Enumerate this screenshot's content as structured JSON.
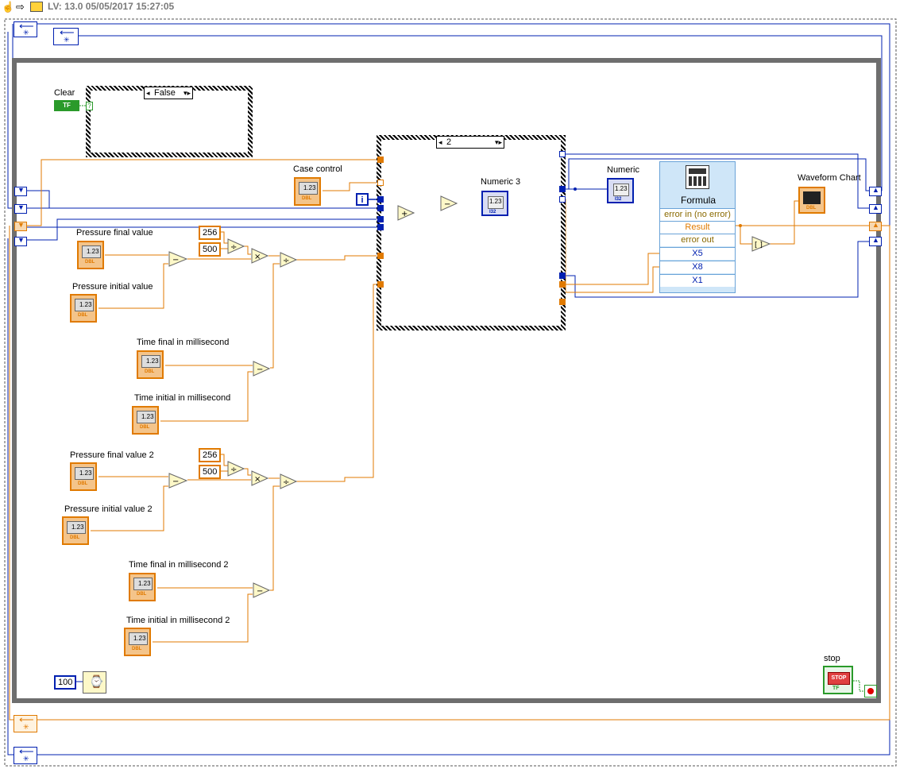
{
  "toolbar": {
    "title": "LV: 13.0 05/05/2017 15:27:05"
  },
  "controls": {
    "clear_label": "Clear",
    "case_control_label": "Case control",
    "pressure_final_label": "Pressure final value",
    "pressure_initial_label": "Pressure initial value",
    "time_final_label": "Time  final in millisecond",
    "time_initial_label": "Time initial in millisecond",
    "pressure_final2_label": "Pressure final value 2",
    "pressure_initial2_label": "Pressure initial value 2",
    "time_final2_label": "Time  final in millisecond 2",
    "time_initial2_label": "Time initial in millisecond 2",
    "stop_label": "stop",
    "numeric_text": "1.23",
    "dbl_tag": "DBL",
    "tf_tag": "TF",
    "stop_text": "STOP"
  },
  "indicators": {
    "numeric3_label": "Numeric 3",
    "numeric_label": "Numeric",
    "waveform_label": "Waveform Chart",
    "i32_tag": "I32"
  },
  "constants": {
    "c256_a": "256",
    "c500_a": "500",
    "c256_b": "256",
    "c500_b": "500",
    "wait_ms": "100",
    "iter_i": "i"
  },
  "cases": {
    "outer_case_value": "False",
    "inner_case_value": "2",
    "bool_tag": "?"
  },
  "formula": {
    "title": "Formula",
    "rows": [
      "error in (no error)",
      "Result",
      "error out",
      "X5",
      "X8",
      "X1"
    ]
  },
  "operators": {
    "minus": "−",
    "plus": "+",
    "divide": "÷",
    "multiply": "×"
  },
  "colors": {
    "wire_blue": "#0020b0",
    "wire_orange": "#e07a00",
    "loop_gray": "#6e6e6e",
    "formula_bg": "#cfe6f8"
  }
}
